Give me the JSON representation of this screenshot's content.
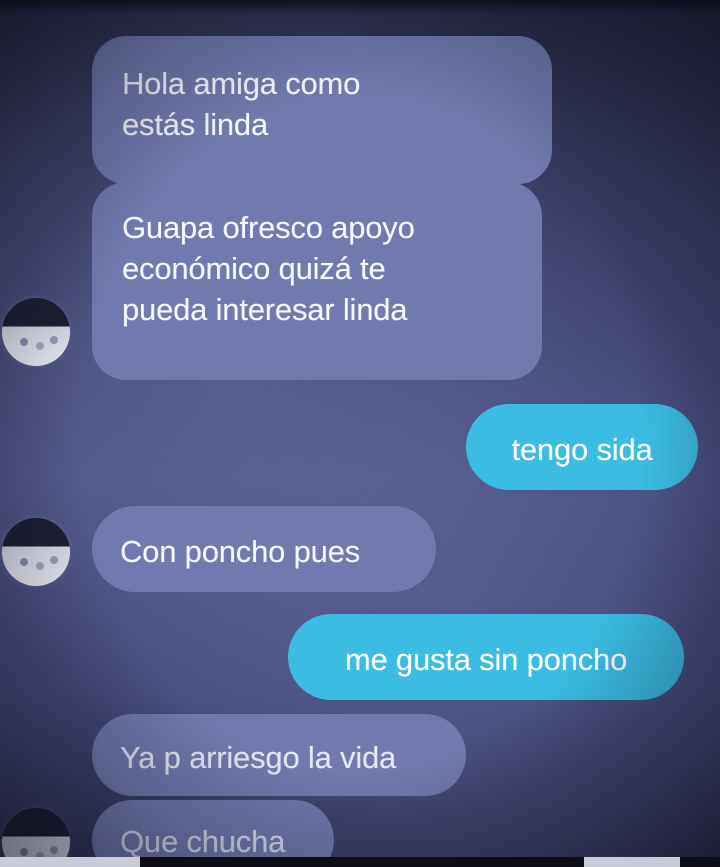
{
  "conversation": {
    "messages": [
      {
        "direction": "incoming",
        "text": "Hola amiga como\nestás linda"
      },
      {
        "direction": "incoming",
        "text": "Guapa ofresco apoyo\neconómico quizá te\npueda interesar linda"
      },
      {
        "direction": "outgoing",
        "text": "tengo sida"
      },
      {
        "direction": "incoming",
        "text": "Con poncho pues"
      },
      {
        "direction": "outgoing",
        "text": "me gusta sin poncho"
      },
      {
        "direction": "incoming",
        "text": "Ya p arriesgo la vida"
      },
      {
        "direction": "incoming",
        "text": "Que chucha"
      }
    ]
  },
  "colors": {
    "background": "#444a7a",
    "incoming_bubble": "#707aae",
    "outgoing_bubble": "#3bbde3",
    "text": "#ffffff"
  },
  "icons": [
    "contact-avatar-icon"
  ]
}
